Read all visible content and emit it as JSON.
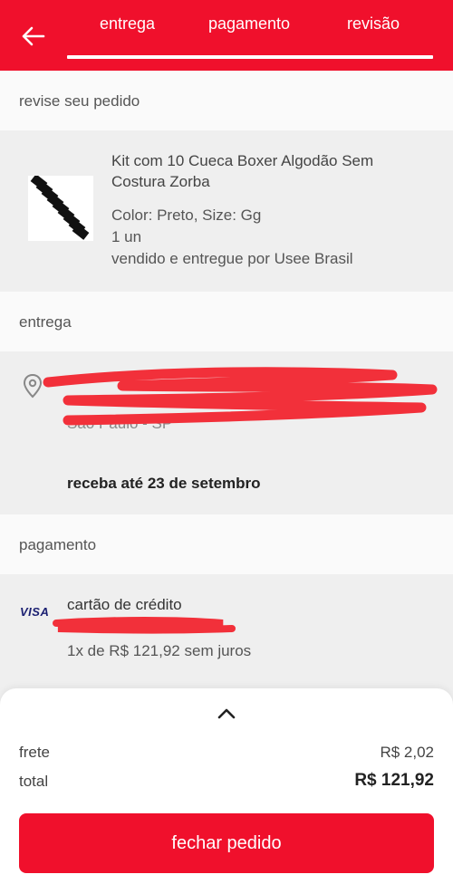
{
  "header": {
    "tabs": [
      {
        "label": "entrega"
      },
      {
        "label": "pagamento"
      },
      {
        "label": "revisão"
      }
    ],
    "active_tab": "revisão",
    "progress": 1.0
  },
  "review": {
    "section_title": "revise seu pedido",
    "product": {
      "title": "Kit com 10 Cueca Boxer Algodão Sem Costura Zorba",
      "variant": "Color: Preto, Size: Gg",
      "quantity": "1 un",
      "seller": "vendido e entregue por Usee Brasil"
    }
  },
  "delivery": {
    "section_title": "entrega",
    "address_visible_fragment": "São Paulo - SP",
    "estimate": "receba até 23 de setembro"
  },
  "payment": {
    "section_title": "pagamento",
    "card_brand": "VISA",
    "method": "cartão de crédito",
    "installments": "1x de R$ 121,92 sem juros"
  },
  "summary": {
    "shipping_label": "frete",
    "shipping_value": "R$ 2,02",
    "total_label": "total",
    "total_value": "R$ 121,92",
    "checkout_label": "fechar pedido"
  },
  "colors": {
    "brand_red": "#f0102c",
    "redaction_red": "#f2303a",
    "visa_blue": "#1a1f71"
  }
}
